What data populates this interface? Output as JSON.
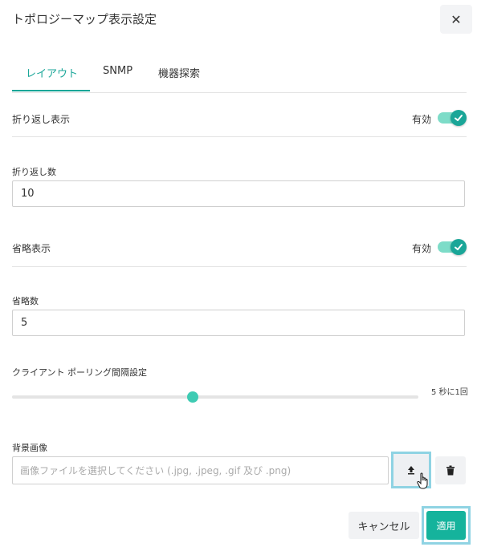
{
  "dialog": {
    "title": "トポロジーマップ表示設定",
    "close_symbol": "✕"
  },
  "tabs": [
    {
      "label": "レイアウト",
      "active": true
    },
    {
      "label": "SNMP",
      "active": false
    },
    {
      "label": "機器探索",
      "active": false
    }
  ],
  "wrap_display": {
    "label": "折り返し表示",
    "status": "有効",
    "enabled": true
  },
  "wrap_count": {
    "label": "折り返し数",
    "value": "10"
  },
  "abbrev_display": {
    "label": "省略表示",
    "status": "有効",
    "enabled": true
  },
  "abbrev_count": {
    "label": "省略数",
    "value": "5"
  },
  "polling": {
    "label": "クライアント ポーリング間隔設定",
    "value_text": "5 秒に1回"
  },
  "background_image": {
    "label": "背景画像",
    "placeholder": "画像ファイルを選択してください (.jpg, .jpeg, .gif 及び .png)",
    "upload_icon": "upload-icon",
    "delete_icon": "trash-icon"
  },
  "footer": {
    "cancel_label": "キャンセル",
    "apply_label": "適用"
  },
  "colors": {
    "accent": "#1aa698",
    "apply": "#15b39c",
    "toggle_track": "#7ddcc8",
    "highlight": "#8fd3e3"
  }
}
